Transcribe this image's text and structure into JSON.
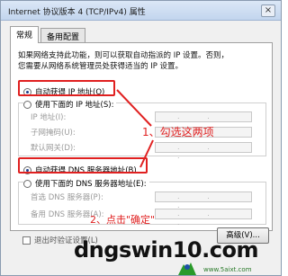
{
  "window": {
    "title": "Internet 协议版本 4 (TCP/IPv4) 属性",
    "close": "×"
  },
  "tabs": [
    {
      "label": "常规"
    },
    {
      "label": "备用配置"
    }
  ],
  "description": [
    "如果网络支持此功能，则可以获取自动指派的 IP 设置。否则，",
    "您需要从网络系统管理员处获得适当的 IP 设置。"
  ],
  "ip": {
    "auto_label": "自动获得 IP 地址(O)",
    "manual_label": "使用下面的 IP 地址(S):",
    "fields": [
      {
        "label": "IP 地址(I):",
        "value": ". . ."
      },
      {
        "label": "子网掩码(U):",
        "value": ". . ."
      },
      {
        "label": "默认网关(D):",
        "value": ". . ."
      }
    ]
  },
  "dns": {
    "auto_label": "自动获得 DNS 服务器地址(B)",
    "manual_label": "使用下面的 DNS 服务器地址(E):",
    "fields": [
      {
        "label": "首选 DNS 服务器(P):",
        "value": ". . ."
      },
      {
        "label": "备用 DNS 服务器(A):",
        "value": ". . ."
      }
    ]
  },
  "checkbox_label": "退出时验证设置(L)",
  "buttons": {
    "advanced": "高级(V)..."
  },
  "annotations": {
    "step1": "1、勾选这两项",
    "step2": "2、点击\"确定\""
  },
  "watermark": {
    "text": "dngswin10.com",
    "url": "www.5aixt.com"
  },
  "colors": {
    "annotation": "#e02020",
    "radio_selected": "#1c3d8a",
    "watermark_url": "#2a7a2a"
  }
}
